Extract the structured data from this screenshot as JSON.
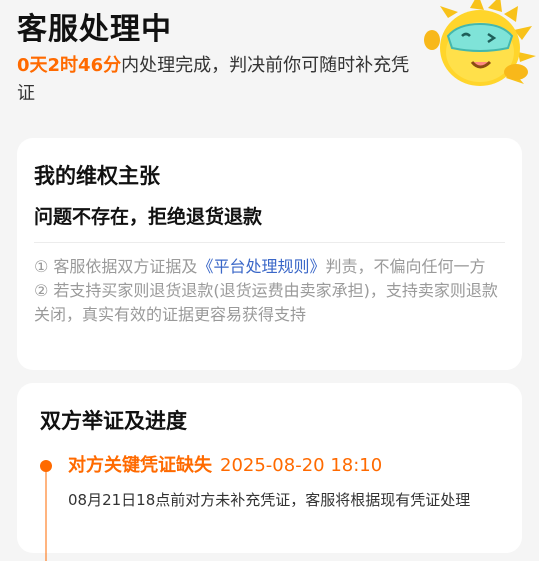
{
  "header": {
    "title": "客服处理中",
    "countdown": "0天2时46分",
    "subtitle_rest": "内处理完成，判决前你可随时补充凭证"
  },
  "claim_card": {
    "title": "我的维权主张",
    "claim": "问题不存在，拒绝退货退款",
    "rule1_prefix": "① 客服依据双方证据及",
    "rule1_link": "《平台处理规则》",
    "rule1_suffix": "判责，不偏向任何一方",
    "rule2": "② 若支持买家则退货退款(退货运费由卖家承担)，支持卖家则退款关闭，真实有效的证据更容易获得支持"
  },
  "progress_card": {
    "title": "双方举证及进度",
    "event": {
      "status": "对方关键凭证缺失",
      "time": "2025-08-20 18:10",
      "description": "08月21日18点前对方未补充凭证，客服将根据现有凭证处理"
    }
  },
  "colors": {
    "accent": "#ff6a00",
    "link": "#3a67c8",
    "background": "#f5f5f5"
  },
  "icons": {
    "mascot": "mascot-illustration"
  }
}
